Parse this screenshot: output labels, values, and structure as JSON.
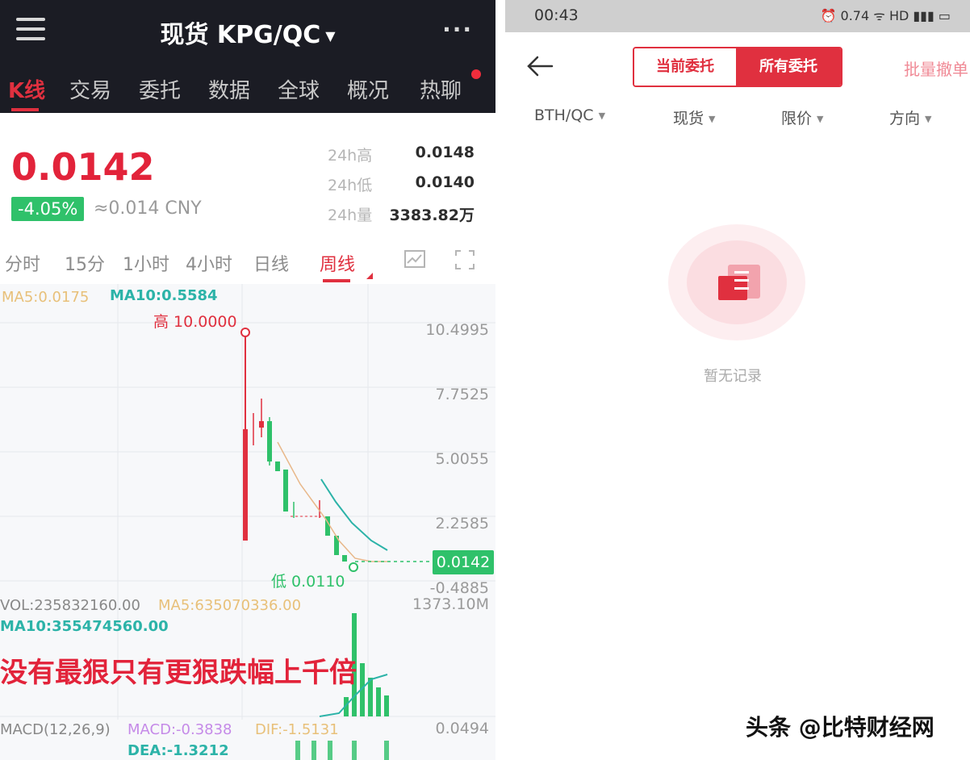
{
  "left": {
    "title": "现货 KPG/QC",
    "nav_tabs": [
      "K线",
      "交易",
      "委托",
      "数据",
      "全球",
      "概况",
      "热聊"
    ],
    "price": "0.0142",
    "change": "-4.05%",
    "cny": "≈0.014 CNY",
    "stats": [
      {
        "label": "24h高",
        "value": "0.0148"
      },
      {
        "label": "24h低",
        "value": "0.0140"
      },
      {
        "label": "24h量",
        "value": "3383.82万"
      }
    ],
    "periods": [
      "分时",
      "15分",
      "1小时",
      "4小时",
      "日线",
      "周线"
    ],
    "ma5": "MA5:0.0175",
    "ma10": "MA10:0.5584",
    "high_label": "高 10.0000",
    "low_label": "低 0.0110",
    "y_axis": [
      "10.4995",
      "7.7525",
      "5.0055",
      "2.2585",
      "-0.4885"
    ],
    "current_price_tag": "0.0142",
    "vol_max": "1373.10M",
    "vol": "VOL:235832160.00",
    "vol_ma5": "MA5:635070336.00",
    "vol_ma10": "MA10:355474560.00",
    "overlay_text": "没有最狠只有更狠跌幅上千倍",
    "macd_title": "MACD(12,26,9)",
    "macd": "MACD:-0.3838",
    "dif": "DIF:-1.5131",
    "dea": "DEA:-1.3212",
    "macd_axis": "0.0494"
  },
  "right": {
    "status_time": "00:43",
    "status_icons": "⏰ 0.74 ᯤ HD ▮▮▮ ▭",
    "segment": [
      "当前委托",
      "所有委托"
    ],
    "batch_cancel": "批量撤单",
    "filters": [
      "BTH/QC",
      "现货",
      "限价",
      "方向"
    ],
    "empty_text": "暂无记录"
  },
  "watermark": "头条 @比特财经网",
  "colors": {
    "red": "#e0303f",
    "green": "#2fc16a",
    "dark_bar": "#1b1c24"
  }
}
